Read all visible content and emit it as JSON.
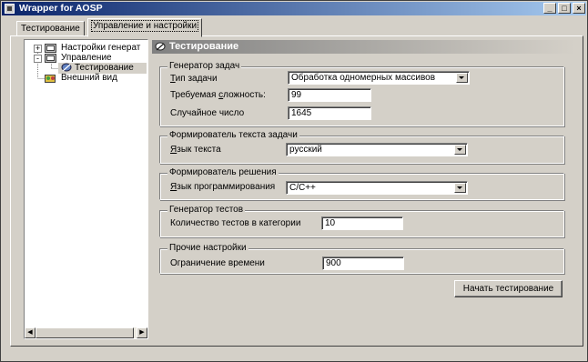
{
  "window": {
    "title": "Wrapper for AOSP"
  },
  "tabs": [
    {
      "label": "Тестирование"
    },
    {
      "label": "Управление и настройки"
    }
  ],
  "tree": {
    "items": [
      {
        "label": "Настройки генерат",
        "expander": "+"
      },
      {
        "label": "Управление",
        "expander": "-"
      },
      {
        "label": "Тестирование"
      },
      {
        "label": "Внешний вид"
      }
    ]
  },
  "panel": {
    "title": "Тестирование"
  },
  "task_generator": {
    "legend": "Генератор задач",
    "task_type": {
      "label_before": "",
      "label_underlined": "Т",
      "label_after": "ип задачи",
      "value": "Обработка одномерных массивов"
    },
    "difficulty": {
      "label_before": "Требуемая ",
      "label_underlined": "с",
      "label_after": "ложность:",
      "value": "99"
    },
    "random_number": {
      "label": "Случайное число",
      "value": "1645"
    }
  },
  "text_former": {
    "legend": "Формирователь текста задачи",
    "language": {
      "label_before": "",
      "label_underlined": "Я",
      "label_after": "зык текста",
      "value": "русский"
    }
  },
  "solution_former": {
    "legend": "Формирователь решения",
    "prog_language": {
      "label_before": "",
      "label_underlined": "Я",
      "label_after": "зык программирования",
      "value": "C/C++"
    }
  },
  "test_generator": {
    "legend": "Генератор тестов",
    "tests_count": {
      "label": "Количество тестов в категории",
      "value": "10"
    }
  },
  "other_settings": {
    "legend": "Прочие настройки",
    "time_limit": {
      "label": "Ограничение времени",
      "value": "900"
    }
  },
  "actions": {
    "start_label": "Начать тестирование"
  }
}
